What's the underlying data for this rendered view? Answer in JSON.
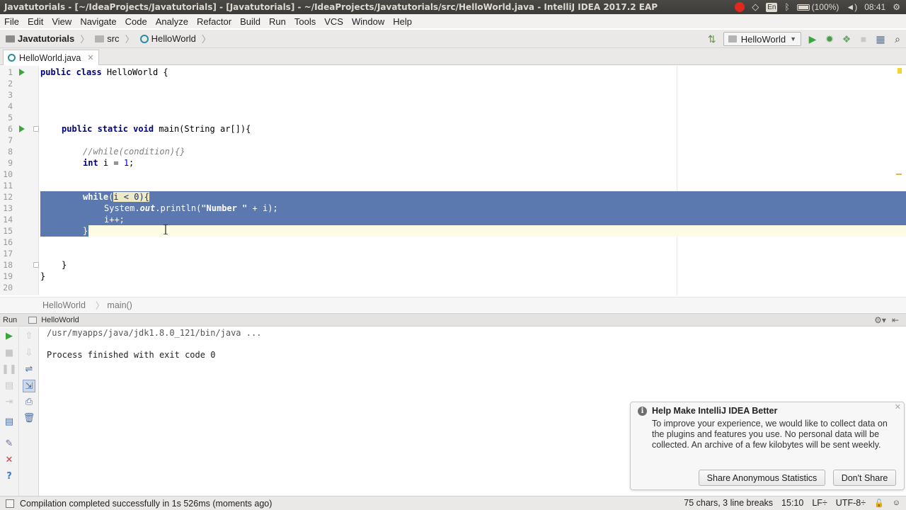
{
  "window": {
    "title": "Javatutorials - [~/IdeaProjects/Javatutorials] - [Javatutorials] - ~/IdeaProjects/Javatutorials/src/HelloWorld.java - IntelliJ IDEA 2017.2 EAP",
    "tray_lang": "En",
    "tray_battery": "(100%)",
    "tray_time": "08:41"
  },
  "menu": [
    "File",
    "Edit",
    "View",
    "Navigate",
    "Code",
    "Analyze",
    "Refactor",
    "Build",
    "Run",
    "Tools",
    "VCS",
    "Window",
    "Help"
  ],
  "nav": {
    "project": "Javatutorials",
    "folder": "src",
    "file": "HelloWorld",
    "run_config": "HelloWorld"
  },
  "tab": {
    "label": "HelloWorld.java"
  },
  "editor": {
    "line_numbers": [
      "1",
      "2",
      "3",
      "4",
      "5",
      "6",
      "7",
      "8",
      "9",
      "10",
      "11",
      "12",
      "13",
      "14",
      "15",
      "16",
      "17",
      "18",
      "19",
      "20"
    ],
    "lines": {
      "l1": {
        "kw": "public class ",
        "rest": "HelloWorld {"
      },
      "l6": {
        "kw": "public static void ",
        "rest": "main(String ar[]){"
      },
      "l8": "//while(condition){}",
      "l9": {
        "kw": "int ",
        "rest": "i = ",
        "num": "1",
        "end": ";"
      },
      "l12": {
        "kw": "while",
        "open": "(",
        "cond_a": "i < ",
        "cond_num": "0",
        "close": "){"
      },
      "l13": {
        "a": "System.",
        "field": "out",
        "b": ".println(",
        "str": "\"Number \"",
        "c": " + i);"
      },
      "l14": "i++;",
      "l15": "}",
      "l18": "}",
      "l19": "}"
    }
  },
  "editor_breadcrumbs": [
    "HelloWorld",
    "main()"
  ],
  "run_window": {
    "tab_label": "Run",
    "config_label": "HelloWorld",
    "console": [
      "/usr/myapps/java/jdk1.8.0_121/bin/java ...",
      "",
      "Process finished with exit code 0"
    ]
  },
  "notification": {
    "title": "Help Make IntelliJ IDEA Better",
    "body": "To improve your experience, we would like to collect data on the plugins and features you use. No personal data will be collected. An archive of a few kilobytes will be sent weekly.",
    "share_button": "Share Anonymous Statistics",
    "dont_share_button": "Don't Share"
  },
  "status": {
    "message": "Compilation completed successfully in 1s 526ms (moments ago)",
    "selection": "75 chars, 3 line breaks",
    "position": "15:10",
    "line_sep": "LF÷",
    "encoding": "UTF-8÷"
  },
  "colors": {
    "selection": "#5b78af",
    "run_green": "#3ba73b",
    "keyword": "#000080",
    "string": "#008000"
  }
}
